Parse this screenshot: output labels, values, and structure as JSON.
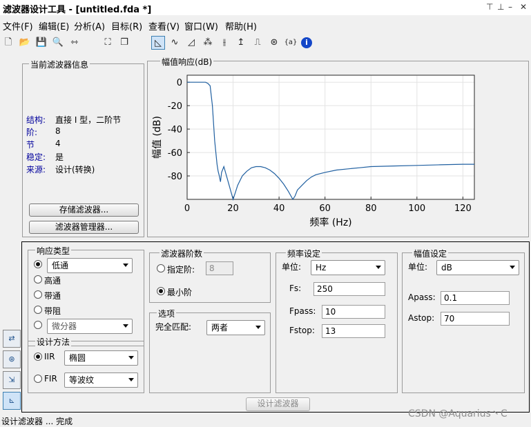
{
  "window": {
    "title": "滤波器设计工具 - [untitled.fda *]",
    "controls": [
      "⊤",
      "⊥",
      "–",
      "✕"
    ]
  },
  "menu": [
    "文件(F)",
    "编辑(E)",
    "分析(A)",
    "目标(R)",
    "查看(V)",
    "窗口(W)",
    "帮助(H)"
  ],
  "toolbar": [
    {
      "icon": "new-icon",
      "glyph": "🗋"
    },
    {
      "icon": "open-icon",
      "glyph": "📂"
    },
    {
      "icon": "save-icon",
      "glyph": "💾"
    },
    {
      "icon": "zoom-in-icon",
      "glyph": "🔍"
    },
    {
      "icon": "zoom-x-icon",
      "glyph": "⇿"
    },
    {
      "icon": "full-view-icon",
      "glyph": "⛶"
    },
    {
      "icon": "specs-icon",
      "glyph": "❐"
    },
    {
      "icon": "magnitude-response-icon",
      "glyph": "◺",
      "active": true
    },
    {
      "icon": "phase-response-icon",
      "glyph": "∿"
    },
    {
      "icon": "magnitude-phase-icon",
      "glyph": "◿"
    },
    {
      "icon": "group-delay-icon",
      "glyph": "⁂"
    },
    {
      "icon": "phase-delay-icon",
      "glyph": "⫲"
    },
    {
      "icon": "impulse-response-icon",
      "glyph": "↥"
    },
    {
      "icon": "step-response-icon",
      "glyph": "⎍"
    },
    {
      "icon": "pole-zero-icon",
      "glyph": "⊛"
    },
    {
      "icon": "coefficients-icon",
      "glyph": "{a}"
    },
    {
      "icon": "info-icon",
      "glyph": "i"
    }
  ],
  "info_panel": {
    "title": "当前滤波器信息",
    "rows": [
      {
        "key": "结构:",
        "value": "直接 I 型，二阶节"
      },
      {
        "key": "阶:",
        "value": "8"
      },
      {
        "key": "节",
        "value": "4"
      },
      {
        "key": "稳定:",
        "value": "是"
      },
      {
        "key": "来源:",
        "value": "设计(转换)"
      }
    ],
    "store_button": "存储滤波器...",
    "manager_button": "滤波器管理器..."
  },
  "plot_panel": {
    "title": "幅值响应(dB)",
    "chart_data": {
      "type": "line",
      "xlabel": "频率 (Hz)",
      "ylabel": "幅值 (dB)",
      "xlim": [
        0,
        125
      ],
      "ylim": [
        -100,
        6
      ],
      "xticks": [
        0,
        20,
        40,
        60,
        80,
        100,
        120
      ],
      "yticks": [
        0,
        -20,
        -40,
        -60,
        -80
      ],
      "grid": true,
      "color": "#1f5fa0",
      "x": [
        0,
        8,
        9,
        10,
        11,
        12,
        13,
        13.5,
        14,
        14.5,
        15,
        16,
        18,
        20,
        22,
        24,
        26,
        28,
        30,
        32,
        34,
        36,
        38,
        40,
        42,
        44,
        46,
        47,
        48,
        50,
        52,
        54,
        56,
        60,
        65,
        70,
        75,
        80,
        90,
        100,
        110,
        120,
        125
      ],
      "y": [
        0,
        0,
        -1,
        -3,
        -20,
        -50,
        -70,
        -76,
        -80,
        -85,
        -77,
        -72,
        -86,
        -100,
        -88,
        -80,
        -76,
        -73,
        -72,
        -72,
        -73,
        -75,
        -78,
        -82,
        -87,
        -93,
        -100,
        -97,
        -92,
        -88,
        -84,
        -81,
        -79,
        -77,
        -75,
        -74,
        -73,
        -72,
        -71.5,
        -71,
        -70.5,
        -70,
        -70
      ]
    }
  },
  "response_type": {
    "title": "响应类型",
    "options": [
      {
        "label": "低通",
        "selected": true,
        "is_dropdown": true
      },
      {
        "label": "高通",
        "selected": false
      },
      {
        "label": "带通",
        "selected": false
      },
      {
        "label": "带阻",
        "selected": false
      },
      {
        "label": "微分器",
        "selected": false,
        "is_dropdown": true
      }
    ]
  },
  "design_method": {
    "title": "设计方法",
    "iir_label": "IIR",
    "iir_value": "椭圆",
    "fir_label": "FIR",
    "fir_value": "等波纹"
  },
  "filter_order": {
    "title": "滤波器阶数",
    "specify_label": "指定阶:",
    "specify_value": "8",
    "minimum_label": "最小阶"
  },
  "options": {
    "title": "选项",
    "match_label": "完全匹配:",
    "match_value": "两者"
  },
  "freq_spec": {
    "title": "频率设定",
    "unit_label": "单位:",
    "unit_value": "Hz",
    "fields": [
      {
        "label": "Fs:",
        "value": "250"
      },
      {
        "label": "Fpass:",
        "value": "10"
      },
      {
        "label": "Fstop:",
        "value": "13"
      }
    ]
  },
  "mag_spec": {
    "title": "幅值设定",
    "unit_label": "单位:",
    "unit_value": "dB",
    "fields": [
      {
        "label": "Apass:",
        "value": "0.1"
      },
      {
        "label": "Astop:",
        "value": "70"
      }
    ]
  },
  "design_button": "设计滤波器",
  "status": {
    "left": "设计滤波器 ... 完成",
    "watermark": "CSDN @Aquarius丶C"
  },
  "side_icons": [
    "transform-icon",
    "pole-zero-editor-icon",
    "import-icon",
    "design-filter-icon"
  ]
}
